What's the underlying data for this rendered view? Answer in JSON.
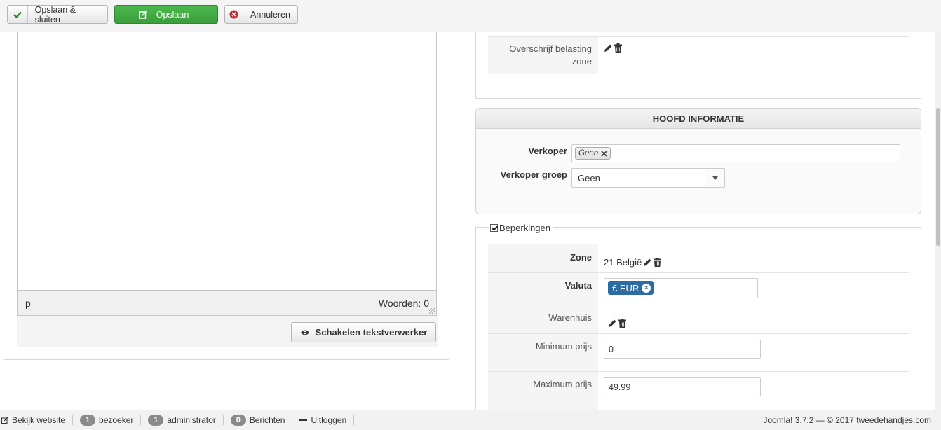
{
  "toolbar": {
    "save_close_label": "Opslaan & sluiten",
    "save_label": "Opslaan",
    "cancel_label": "Annuleren",
    "accent_green": "#3a9d3a",
    "icons": [
      "checkmark-icon",
      "edit-icon",
      "cancel-circle-icon"
    ]
  },
  "editor": {
    "path_label": "p",
    "word_count_label": "Woorden: 0",
    "toggle_label": "Schakelen tekstverwerker"
  },
  "tax_section": {
    "override_label": "Overschrijf belasting zone"
  },
  "main_info": {
    "header": "HOOFD INFORMATIE",
    "seller_label": "Verkoper",
    "seller_chip": "Geen",
    "seller_group_label": "Verkoper groep",
    "seller_group_value": "Geen"
  },
  "restrictions": {
    "legend": "Beperkingen",
    "checked": true,
    "zone_label": "Zone",
    "zone_value": "21 België",
    "currency_label": "Valuta",
    "currency_chip": "€ EUR",
    "currency_chip_color": "#2d6ca2",
    "warehouse_label": "Warenhuis",
    "warehouse_value": "-",
    "min_price_label": "Minimum prijs",
    "min_price_value": "0",
    "max_price_label": "Maximum prijs",
    "max_price_value": "49.99"
  },
  "statusbar": {
    "view_site": "Bekijk website",
    "visitors_count": "1",
    "visitors_label": "bezoeker",
    "admins_count": "1",
    "admins_label": "administrator",
    "messages_count": "0",
    "messages_label": "Berichten",
    "logout_label": "Uitloggen",
    "version_text": "Joomla! 3.7.2  —  © 2017 tweedehandjes.com"
  }
}
